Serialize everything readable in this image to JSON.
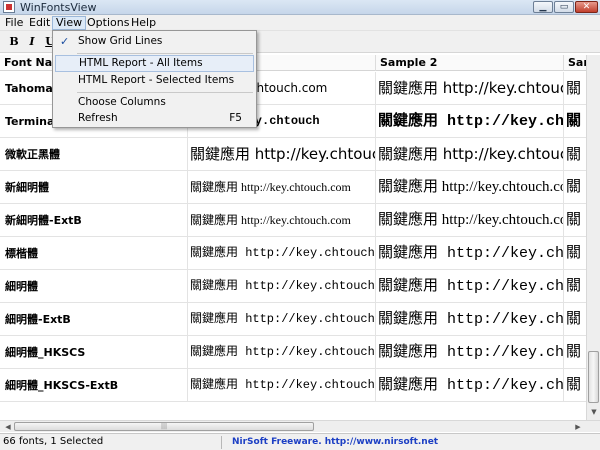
{
  "window": {
    "title": "WinFontsView",
    "controls": {
      "minimize": "▁",
      "maximize": "▭",
      "close": "✕"
    }
  },
  "menubar": [
    "File",
    "Edit",
    "View",
    "Options",
    "Help"
  ],
  "toolbar": {
    "bold": "B",
    "italic": "I",
    "underline": "U"
  },
  "columns": [
    "Font Name",
    "Sample 1",
    "Sample 2",
    "Sam"
  ],
  "rows": [
    {
      "name": "Tahoma",
      "s1": "http://key.chtouch.com",
      "s2": "關鍵應用 http://key.chtouch",
      "s3": "關",
      "font": "f-sans",
      "size": "sz1"
    },
    {
      "name": "Terminal",
      "s1": "http://key.chtouch",
      "s2": "關鍵應用 http://key.chtouch",
      "s3": "關",
      "font": "f-mono bold",
      "size": "sz1"
    },
    {
      "name": "微軟正黑體",
      "s1": "關鍵應用 http://key.chtouch.com",
      "s2": "關鍵應用 http://key.chtouch",
      "s3": "關",
      "font": "f-sans",
      "size": "sz2"
    },
    {
      "name": "新細明體",
      "s1": "關鍵應用 http://key.chtouch.com",
      "s2": "關鍵應用 http://key.chtouch.com",
      "s3": "關",
      "font": "f-serif",
      "size": "sz1"
    },
    {
      "name": "新細明體-ExtB",
      "s1": "關鍵應用 http://key.chtouch.com",
      "s2": "關鍵應用 http://key.chtouch.com",
      "s3": "關",
      "font": "f-serif",
      "size": "sz1"
    },
    {
      "name": "標楷體",
      "s1": "關鍵應用 http://key.chtouch.com",
      "s2": "關鍵應用 http://key.chtouch",
      "s3": "關",
      "font": "f-mono",
      "size": "sz1"
    },
    {
      "name": "細明體",
      "s1": "關鍵應用 http://key.chtouch.com",
      "s2": "關鍵應用 http://key.chtouch",
      "s3": "關",
      "font": "f-mono",
      "size": "sz1"
    },
    {
      "name": "細明體-ExtB",
      "s1": "關鍵應用 http://key.chtouch.com",
      "s2": "關鍵應用 http://key.chtouch",
      "s3": "關",
      "font": "f-mono",
      "size": "sz1"
    },
    {
      "name": "細明體_HKSCS",
      "s1": "關鍵應用 http://key.chtouch.com",
      "s2": "關鍵應用 http://key.chtouch",
      "s3": "關",
      "font": "f-mono",
      "size": "sz1"
    },
    {
      "name": "細明體_HKSCS-ExtB",
      "s1": "關鍵應用 http://key.chtouch.com",
      "s2": "關鍵應用 http://key.chtouch",
      "s3": "關",
      "font": "f-mono",
      "size": "sz1"
    }
  ],
  "view_menu": {
    "items": [
      {
        "label": "Show Grid Lines",
        "checked": true,
        "shortcut": ""
      },
      {
        "label": "HTML Report - All Items",
        "checked": false,
        "shortcut": ""
      },
      {
        "label": "HTML Report - Selected Items",
        "checked": false,
        "shortcut": ""
      },
      {
        "label": "Choose Columns",
        "checked": false,
        "shortcut": ""
      },
      {
        "label": "Refresh",
        "checked": false,
        "shortcut": "F5"
      }
    ],
    "check_glyph": "✓"
  },
  "statusbar": {
    "count": "66 fonts, 1 Selected",
    "credit": "NirSoft Freeware.  http://www.nirsoft.net"
  },
  "scrollbar": {
    "up_arrow": "▲",
    "down_arrow": "▼",
    "left_arrow": "◀",
    "right_arrow": "▶",
    "grip": "|||"
  },
  "colors": {
    "link": "#1c3fc4",
    "menu_highlight": "#e7eef8",
    "close_button": "#c1402d"
  }
}
